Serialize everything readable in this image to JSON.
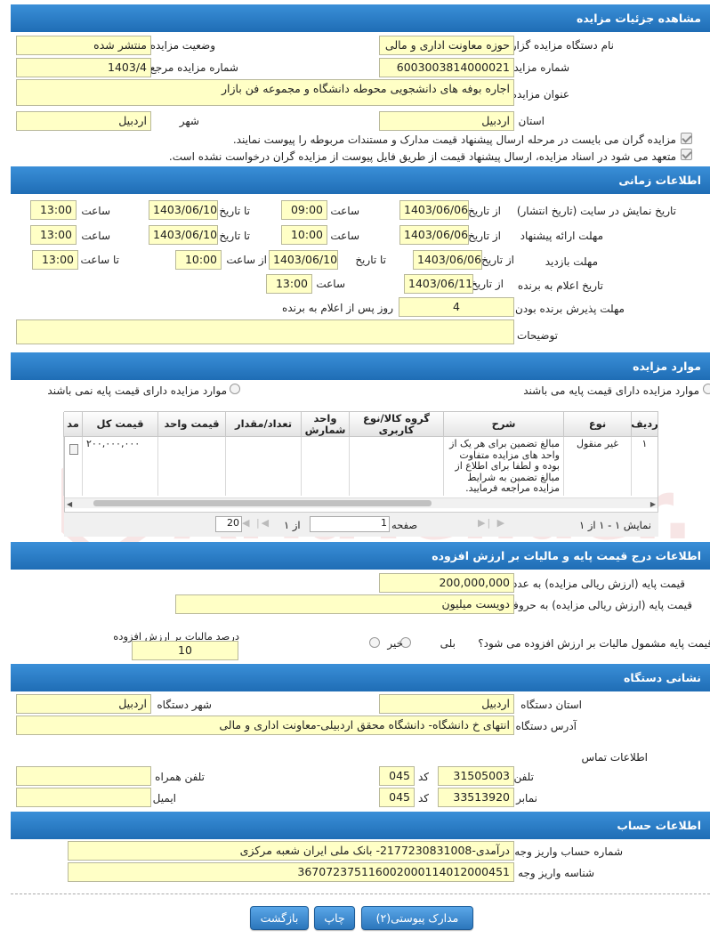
{
  "sections": {
    "details": "مشاهده جزئیات مزایده",
    "timing": "اطلاعات زمانی",
    "items": "موارد مزایده",
    "price": "اطلاعات درج قیمت پایه و مالیات بر ارزش افزوده",
    "address": "نشانی دستگاه",
    "account": "اطلاعات حساب"
  },
  "details": {
    "org_label": "نام دستگاه مزایده گزار",
    "org_value": "حوزه معاونت اداری و مالی",
    "status_label": "وضعیت مزایده",
    "status_value": "منتشر شده",
    "number_label": "شماره مزایده",
    "number_value": "6003003814000021",
    "ref_label": "شماره مزایده مرجع",
    "ref_value": "1403/4",
    "title_label": "عنوان مزایده",
    "title_value": "اجاره بوفه های دانشجویی محوطه دانشگاه و مجموعه فن بازار",
    "province_label": "استان",
    "province_value": "اردبیل",
    "city_label": "شهر",
    "city_value": "اردبیل",
    "check1": "مزایده گران می بایست در مرحله ارسال پیشنهاد قیمت مدارک و مستندات مربوطه را پیوست نمایند.",
    "check2": "متعهد می شود در اسناد مزایده، ارسال پیشنهاد قیمت از طریق فایل پیوست از مزایده گران درخواست نشده است."
  },
  "timing": {
    "row1": {
      "label": "تاریخ نمایش در سایت (تاریخ انتشار)",
      "from_label": "از تاریخ",
      "from": "1403/06/06",
      "time_label": "ساعت",
      "time": "09:00",
      "to_label": "تا تاریخ",
      "to": "1403/06/10",
      "to_time_label": "ساعت",
      "to_time": "13:00"
    },
    "row2": {
      "label": "مهلت ارائه پیشنهاد",
      "from_label": "از تاریخ",
      "from": "1403/06/06",
      "time_label": "ساعت",
      "time": "10:00",
      "to_label": "تا تاریخ",
      "to": "1403/06/10",
      "to_time_label": "ساعت",
      "to_time": "13:00"
    },
    "row3": {
      "label": "مهلت بازدید",
      "from_label": "از تاریخ",
      "from": "1403/06/06",
      "to_label": "تا تاریخ",
      "to": "1403/06/10",
      "from_time_label": "از ساعت",
      "from_time": "10:00",
      "to_time_label": "تا ساعت",
      "to_time": "13:00"
    },
    "row4": {
      "label": "تاریخ اعلام به برنده",
      "from_label": "از تاریخ",
      "from": "1403/06/11",
      "time_label": "ساعت",
      "time": "13:00"
    },
    "row5": {
      "label": "مهلت پذیرش برنده بودن",
      "value": "4",
      "suffix": "روز پس از اعلام به برنده"
    },
    "desc_label": "توضیحات",
    "desc_value": ""
  },
  "items": {
    "radio1": "موارد مزایده دارای قیمت پایه می باشند",
    "radio2": "موارد مزایده دارای قیمت پایه نمی باشند",
    "columns": [
      "ردیف",
      "نوع",
      "شرح",
      "گروه کالا/نوع کاربری",
      "واحد شمارش",
      "تعداد/مقدار",
      "قیمت واحد",
      "قیمت کل",
      "مد"
    ],
    "rows": [
      {
        "index": "۱",
        "type": "غیر منقول",
        "desc": "مبالغ تضمین برای هر یک از واحد های مزایده متفاوت بوده و لطفا برای اطلاع از مبالغ تضمین به شرایط مزایده مراجعه فرمایید.",
        "group": "",
        "unit": "",
        "qty": "",
        "unit_price": "",
        "total": "۲۰۰,۰۰۰,۰۰۰"
      }
    ],
    "pager": {
      "display": "نمایش ۱ - ۱ از ۱",
      "page_label": "صفحه",
      "page_value": "1",
      "of_label": "از ۱",
      "page_size": "20"
    }
  },
  "price": {
    "numeric_label": "قیمت پایه (ارزش ریالی مزایده) به عدد",
    "numeric_value": "200,000,000",
    "words_label": "قیمت پایه (ارزش ریالی مزایده) به حروف",
    "words_value": "دویست میلیون",
    "vat_question": "قیمت پایه مشمول مالیات بر ارزش افزوده می شود؟",
    "yes": "بلی",
    "no": "خیر",
    "vat_percent_label": "درصد مالیات بر ارزش افزوده",
    "vat_percent_value": "10"
  },
  "address": {
    "province_label": "استان دستگاه",
    "province_value": "اردبیل",
    "city_label": "شهر دستگاه",
    "city_value": "اردبیل",
    "addr_label": "آدرس دستگاه",
    "addr_value": "انتهای خ دانشگاه- دانشگاه محقق اردبیلی-معاونت اداری و مالی",
    "contact_title": "اطلاعات تماس",
    "phone_label": "تلفن",
    "phone_value": "31505003",
    "code_label": "کد",
    "phone_code": "045",
    "mobile_label": "تلفن همراه",
    "mobile_value": "",
    "fax_label": "نمابر",
    "fax_value": "33513920",
    "fax_code": "045",
    "email_label": "ایمیل",
    "email_value": ""
  },
  "account": {
    "number_label": "شماره حساب واریز وجه",
    "number_value": "درآمدی-2177230831008- بانک ملی ایران شعبه مرکزی",
    "id_label": "شناسه واریز وجه",
    "id_value": "367072375116002000114012000451"
  },
  "buttons": {
    "attachments": "مدارک پیوستی(۲)",
    "print": "چاپ",
    "back": "بازگشت"
  },
  "watermark": "AriaTender.net"
}
